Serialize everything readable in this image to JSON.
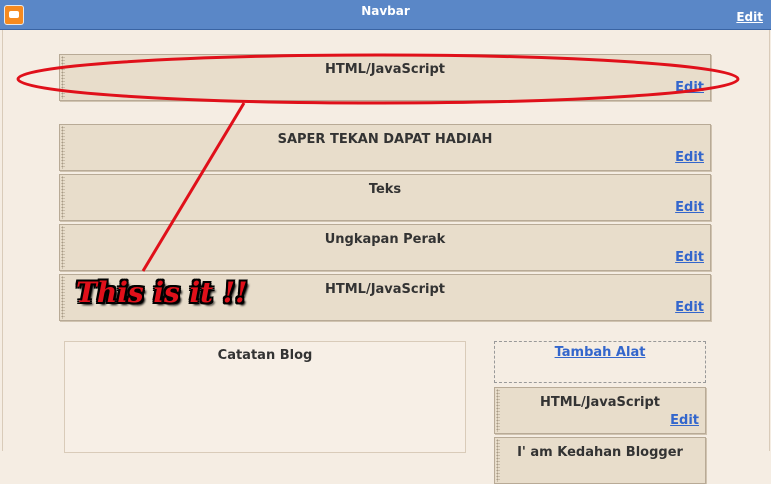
{
  "navbar": {
    "title": "Navbar",
    "edit_label": "Edit"
  },
  "widgets": [
    {
      "title": "HTML/JavaScript",
      "edit_label": "Edit"
    },
    {
      "title": "SAPER TEKAN DAPAT HADIAH",
      "edit_label": "Edit"
    },
    {
      "title": "Teks",
      "edit_label": "Edit"
    },
    {
      "title": "Ungkapan Perak",
      "edit_label": "Edit"
    },
    {
      "title": "HTML/JavaScript",
      "edit_label": "Edit"
    }
  ],
  "main": {
    "blog_title": "Catatan Blog"
  },
  "sidebar": {
    "add_gadget_label": "Tambah Alat",
    "widgets": [
      {
        "title": "HTML/JavaScript",
        "edit_label": "Edit"
      },
      {
        "title": "I' am Kedahan Blogger"
      }
    ]
  },
  "annotation": {
    "text": "This is it !!",
    "color": "#e0101a"
  }
}
